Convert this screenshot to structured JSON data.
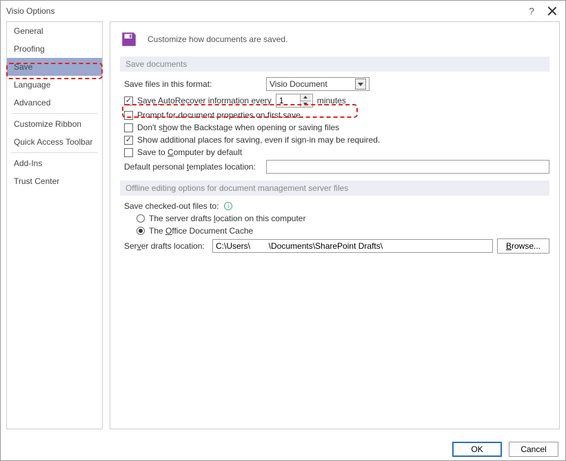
{
  "window": {
    "title": "Visio Options"
  },
  "sidebar": {
    "items": [
      {
        "label": "General"
      },
      {
        "label": "Proofing"
      },
      {
        "label": "Save",
        "selected": true
      },
      {
        "label": "Language"
      },
      {
        "label": "Advanced"
      },
      {
        "label": "Customize Ribbon"
      },
      {
        "label": "Quick Access Toolbar"
      },
      {
        "label": "Add-Ins"
      },
      {
        "label": "Trust Center"
      }
    ]
  },
  "header": {
    "text": "Customize how documents are saved."
  },
  "section1": {
    "title": "Save documents",
    "format_label": "Save files in this format:",
    "format_value": "Visio Document",
    "autorecover_label_pre": "Save ",
    "autorecover_label_mid": "utoRecover information every",
    "autorecover_value": "1",
    "autorecover_unit_pre": "m",
    "autorecover_unit_u": "i",
    "autorecover_unit_post": "nutes",
    "prompt_label": "Prompt for document properties on first save",
    "backstage_pre": "Don't s",
    "backstage_u": "h",
    "backstage_post": "ow the Backstage when opening or saving files",
    "additional_label": "Show additional places for saving, even if sign-in may be required.",
    "computer_pre": "Save to ",
    "computer_u": "C",
    "computer_post": "omputer by default",
    "templates_pre": "Default personal ",
    "templates_u": "t",
    "templates_post": "emplates location:",
    "templates_value": ""
  },
  "section2": {
    "title": "Offline editing options for document management server files",
    "checked_out_label": "Save checked-out files to:",
    "radio1_pre": "The server drafts ",
    "radio1_u": "l",
    "radio1_post": "ocation on this computer",
    "radio2_pre": "The ",
    "radio2_u": "O",
    "radio2_post": "ffice Document Cache",
    "server_loc_pre": "Ser",
    "server_loc_u": "v",
    "server_loc_post": "er drafts location:",
    "server_loc_value": "C:\\Users\\        \\Documents\\SharePoint Drafts\\",
    "browse_pre": "",
    "browse_u": "B",
    "browse_post": "rowse..."
  },
  "footer": {
    "ok": "OK",
    "cancel": "Cancel"
  }
}
